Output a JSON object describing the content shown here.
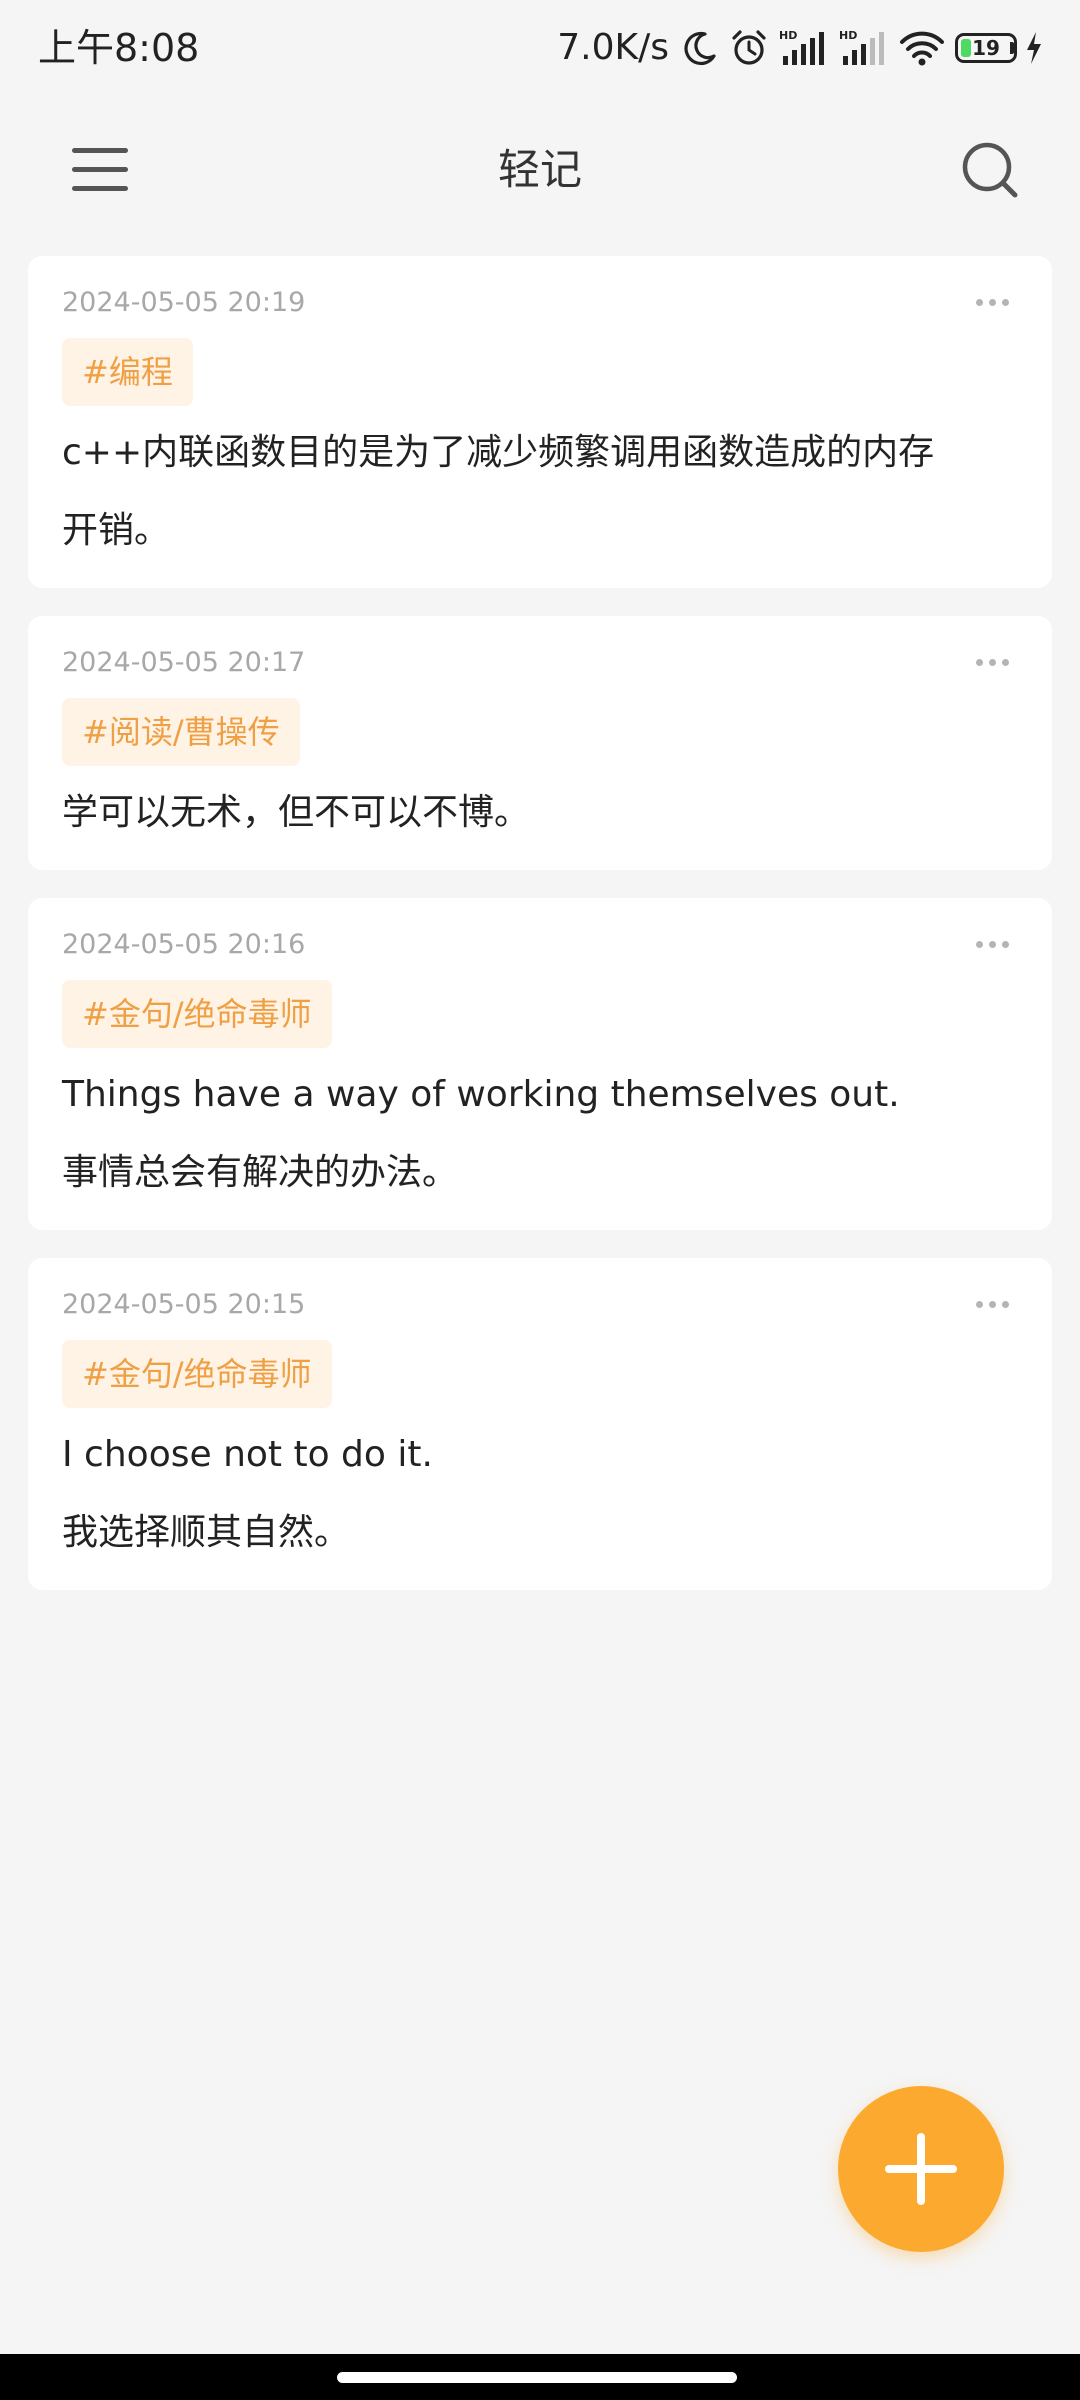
{
  "status_bar": {
    "time": "上午8:08",
    "net_speed": "7.0K/s",
    "battery_level": "19",
    "battery_fraction": 0.19,
    "icons": [
      "moon-icon",
      "alarm-icon",
      "signal-hd-icon",
      "signal-hd-icon",
      "wifi-icon",
      "battery-icon",
      "charging-icon"
    ]
  },
  "app_bar": {
    "title": "轻记",
    "menu_icon": "hamburger-menu-icon",
    "search_icon": "search-icon"
  },
  "notes": [
    {
      "date": "2024-05-05 20:19",
      "tag": "#编程",
      "lines": [
        "c++内联函数目的是为了减少频繁调用函数造成的内存",
        "开销。"
      ]
    },
    {
      "date": "2024-05-05 20:17",
      "tag": "#阅读/曹操传",
      "lines": [
        "学可以无术，但不可以不博。"
      ]
    },
    {
      "date": "2024-05-05 20:16",
      "tag": "#金句/绝命毒师",
      "lines": [
        "Things have a way of working themselves out.",
        "事情总会有解决的办法。"
      ]
    },
    {
      "date": "2024-05-05 20:15",
      "tag": "#金句/绝命毒师",
      "lines": [
        "I choose not to do it.",
        "我选择顺其自然。"
      ]
    }
  ],
  "fab": {
    "icon": "plus-icon",
    "color": "#fca930"
  },
  "colors": {
    "background": "#f5f5f5",
    "card": "#ffffff",
    "tag_background": "#fff3e6",
    "tag_text": "#f0a044",
    "date_text": "#a8a8a8",
    "battery_green": "#4cd964"
  }
}
